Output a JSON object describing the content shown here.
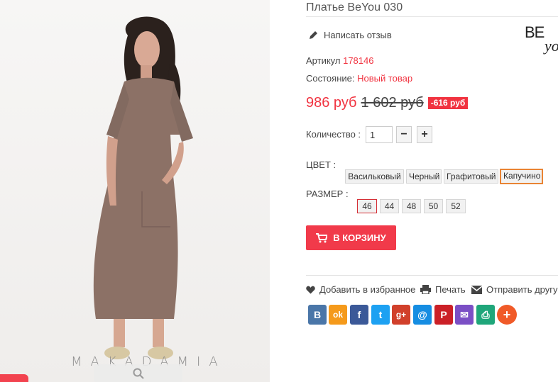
{
  "product": {
    "title": "Платье BeYou 030",
    "brand_logo_text": "BEyo",
    "watermark": "MAKADAMIA",
    "review_link": "Написать отзыв",
    "sku_label": "Артикул",
    "sku_value": "178146",
    "condition_label": "Состояние:",
    "condition_value": "Новый товар",
    "price_new": "986 руб",
    "price_old": "1 602 руб",
    "discount": "-616 руб",
    "quantity_label": "Количество :",
    "quantity_value": "1",
    "quantity_minus": "−",
    "quantity_plus": "+",
    "color_label": "ЦВЕТ :",
    "colors": [
      "Васильковый",
      "Черный",
      "Графитовый",
      "Капучино"
    ],
    "selected_color": "Капучино",
    "size_label": "РАЗМЕР :",
    "sizes": [
      "46",
      "44",
      "48",
      "50",
      "52"
    ],
    "selected_size": "46",
    "add_to_cart": "В КОРЗИНУ"
  },
  "actions": {
    "wishlist": "Добавить в избранное",
    "print": "Печать",
    "send": "Отправить другу"
  },
  "social": [
    {
      "name": "vk",
      "glyph": "В",
      "color": "#4a76a8"
    },
    {
      "name": "odnoklassniki",
      "glyph": "ok",
      "color": "#f59a1b"
    },
    {
      "name": "facebook",
      "glyph": "f",
      "color": "#3b5998"
    },
    {
      "name": "twitter",
      "glyph": "t",
      "color": "#1da1f2"
    },
    {
      "name": "google-plus",
      "glyph": "g+",
      "color": "#d1402b"
    },
    {
      "name": "mail-ru",
      "glyph": "@",
      "color": "#168de2"
    },
    {
      "name": "pinterest",
      "glyph": "P",
      "color": "#cb2027"
    },
    {
      "name": "email",
      "glyph": "✉",
      "color": "#7b4fc5"
    },
    {
      "name": "print",
      "glyph": "⎙",
      "color": "#1fa67a"
    },
    {
      "name": "more",
      "glyph": "+",
      "color": "#f05a28"
    }
  ],
  "colors": {
    "accent": "#f13340",
    "button": "#f13a4a",
    "selected_color_border": "#e98434",
    "selected_size_border": "#d52f36",
    "dress": "#8c7166"
  }
}
